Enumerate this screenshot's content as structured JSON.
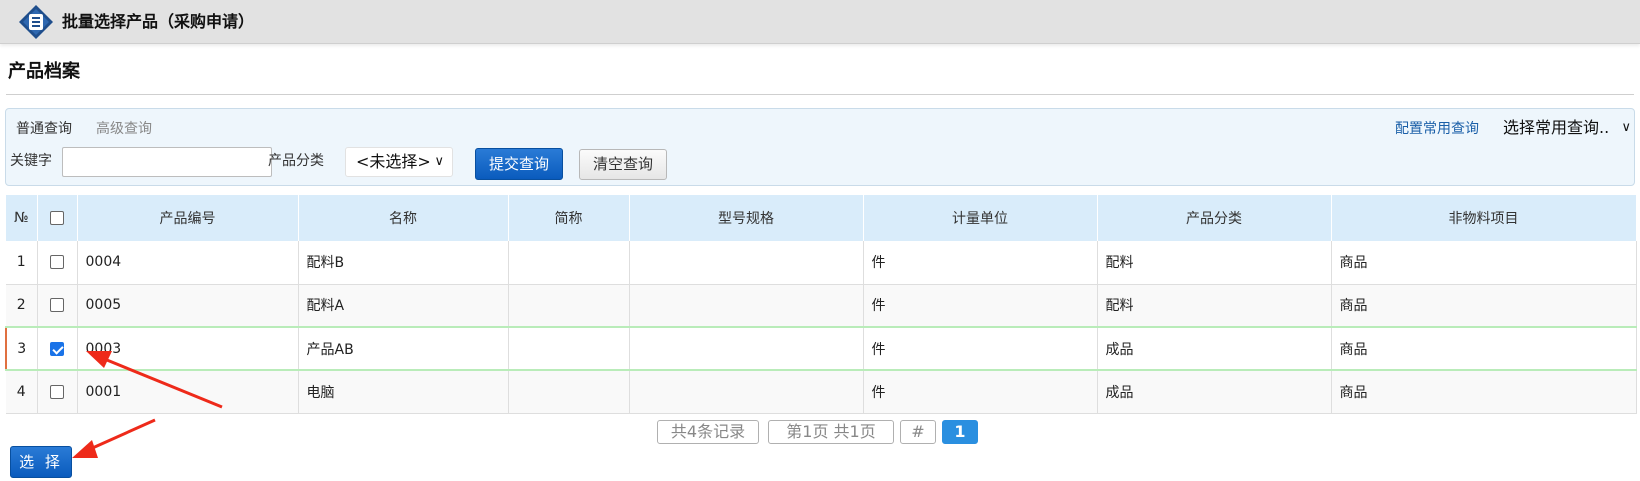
{
  "window": {
    "title": "批量选择产品（采购申请）"
  },
  "section": {
    "title": "产品档案"
  },
  "query": {
    "tabs": [
      {
        "label": "普通查询",
        "active": true
      },
      {
        "label": "高级查询",
        "active": false
      }
    ],
    "config_link": "配置常用查询",
    "common_query_select": "选择常用查询..",
    "keyword_label": "关键字",
    "keyword_value": "",
    "category_label": "产品分类",
    "category_selected": "<未选择>",
    "submit_label": "提交查询",
    "clear_label": "清空查询"
  },
  "table": {
    "columns": [
      "№",
      "",
      "产品编号",
      "名称",
      "简称",
      "型号规格",
      "计量单位",
      "产品分类",
      "非物料项目"
    ],
    "rows": [
      {
        "no": "1",
        "checked": false,
        "code": "0004",
        "name": "配料B",
        "short": "",
        "spec": "",
        "unit": "件",
        "category": "配料",
        "nonmaterial": "商品"
      },
      {
        "no": "2",
        "checked": false,
        "code": "0005",
        "name": "配料A",
        "short": "",
        "spec": "",
        "unit": "件",
        "category": "配料",
        "nonmaterial": "商品"
      },
      {
        "no": "3",
        "checked": true,
        "code": "0003",
        "name": "产品AB",
        "short": "",
        "spec": "",
        "unit": "件",
        "category": "成品",
        "nonmaterial": "商品"
      },
      {
        "no": "4",
        "checked": false,
        "code": "0001",
        "name": "电脑",
        "short": "",
        "spec": "",
        "unit": "件",
        "category": "成品",
        "nonmaterial": "商品"
      }
    ]
  },
  "pager": {
    "total": "共4条记录",
    "page_info": "第1页 共1页",
    "hash": "#",
    "current": "1"
  },
  "actions": {
    "select_label": "选 择"
  },
  "colors": {
    "accent_blue": "#0a5bbd",
    "header_bg": "#d9ecfa",
    "annotation_red": "#ee2a1a"
  }
}
